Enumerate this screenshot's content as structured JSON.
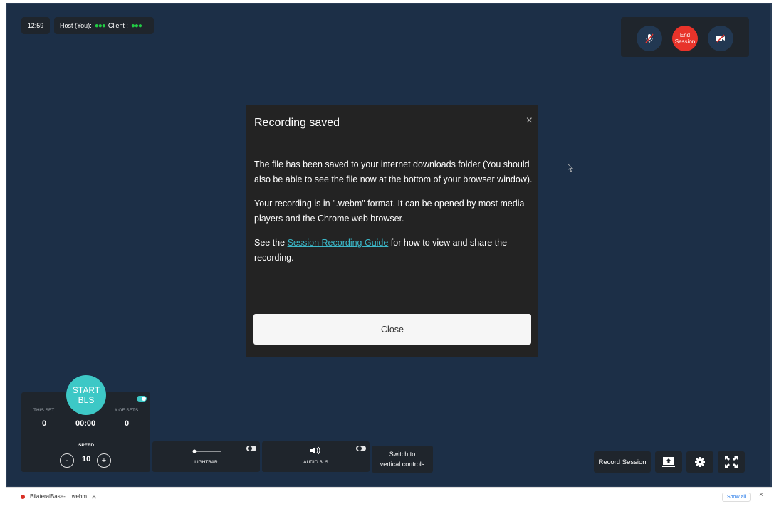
{
  "top_left": {
    "time": "12:59",
    "host_label": "Host (You):",
    "client_label": "Client :",
    "dots": "●●●"
  },
  "call_controls": {
    "end_label_line1": "End",
    "end_label_line2": "Session"
  },
  "modal": {
    "title": "Recording saved",
    "close_icon": "×",
    "para1": "The file has been saved to your internet downloads folder (You should also be able to see the file now at the bottom of your browser window).",
    "para2": "Your recording is in \".webm\" format. It can be opened by most media players and the Chrome web browser.",
    "para3_before": "See the ",
    "para3_link": "Session Recording Guide",
    "para3_after": " for how to view and share the recording.",
    "close_button": "Close"
  },
  "bls": {
    "start_line1": "START",
    "start_line2": "BLS",
    "this_set_label": "THIS SET",
    "this_set_value": "0",
    "timer": "00:00",
    "sets_label": "# OF SETS",
    "sets_value": "0",
    "speed_label": "SPEED",
    "speed_value": "10",
    "minus": "-",
    "plus": "+"
  },
  "controls": {
    "lightbar_label": "LIGHTBAR",
    "audio_label": "AUDIO BLS",
    "switch_line1": "Switch to",
    "switch_line2": "vertical controls",
    "record_session": "Record Session"
  },
  "downloads": {
    "file_name": "BilateralBase-....webm",
    "show_all": "Show all",
    "close": "×"
  },
  "colors": {
    "background": "#1c2f47",
    "panel": "#1f252c",
    "accent": "#3dc8c6",
    "danger": "#e8332a",
    "link": "#3bb8c9"
  }
}
